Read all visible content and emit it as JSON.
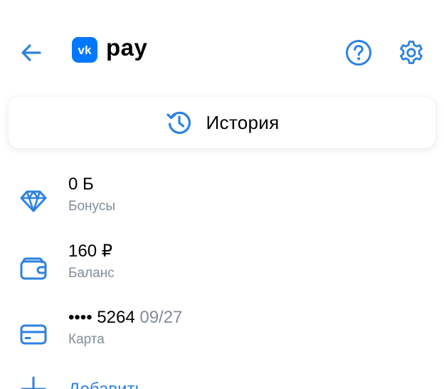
{
  "colors": {
    "accent": "#2d81e0",
    "brand": "#0077ff",
    "secondary_text": "#818c99",
    "primary_text": "#000000"
  },
  "header": {
    "back_icon": "arrow-left-icon",
    "logo_badge_text": "vk",
    "logo_text": "pay",
    "help_icon": "question-circle-icon",
    "settings_icon": "gear-icon"
  },
  "history": {
    "icon": "history-clock-icon",
    "label": "История"
  },
  "items": [
    {
      "icon": "diamond-icon",
      "title": "0 Б",
      "subtitle": "Бонусы"
    },
    {
      "icon": "wallet-icon",
      "title": "160 ₽",
      "subtitle": "Баланс"
    },
    {
      "icon": "card-icon",
      "title_masked": "•••• 5264",
      "title_extra": "09/27",
      "subtitle": "Карта"
    }
  ],
  "add": {
    "icon": "plus-icon",
    "label": "Добавить"
  }
}
